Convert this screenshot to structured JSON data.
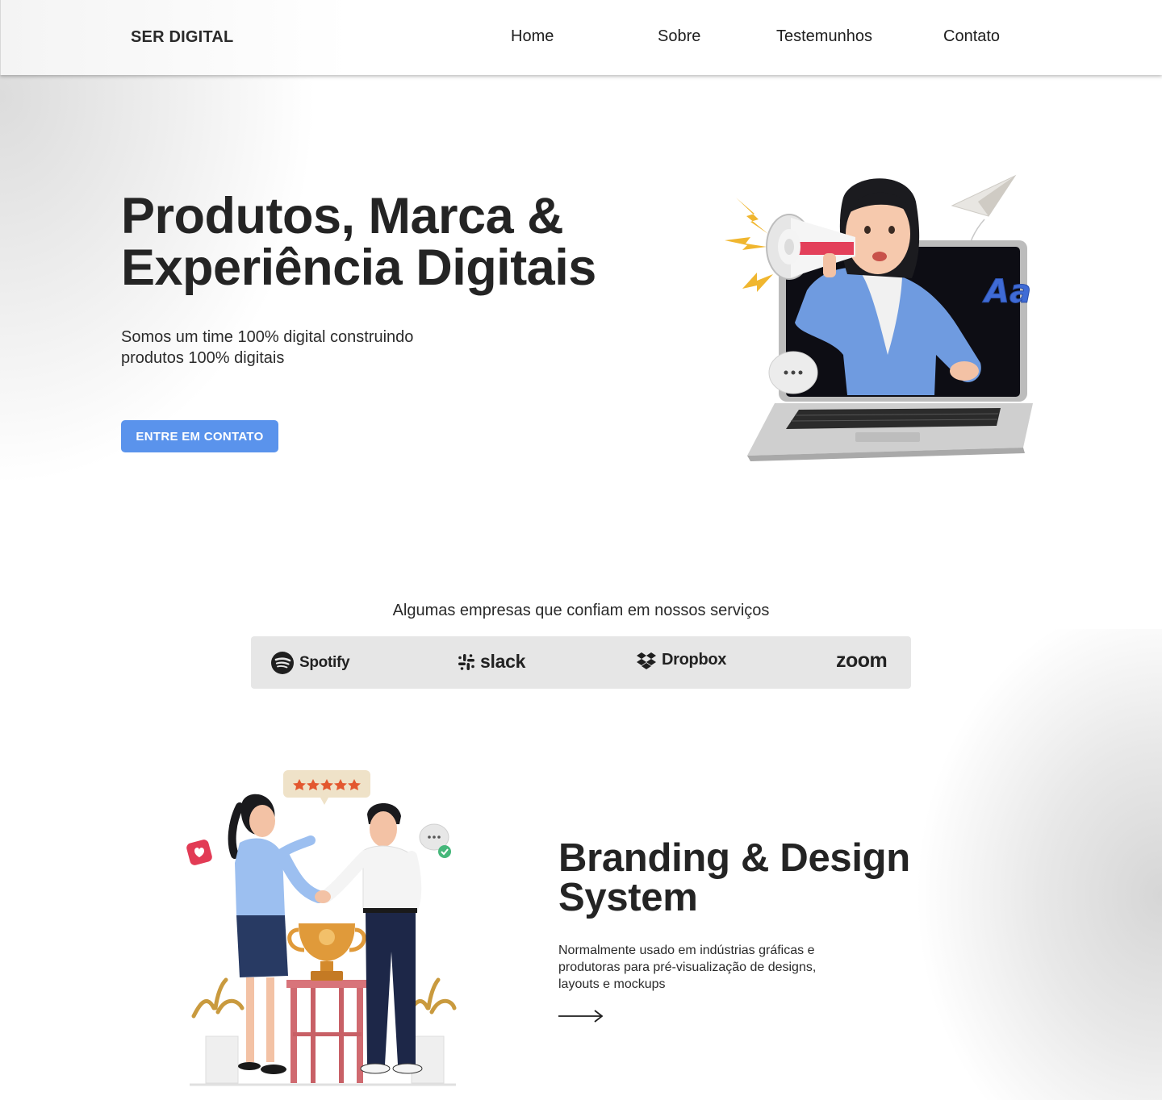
{
  "header": {
    "logo": "SER DIGITAL",
    "nav": [
      {
        "label": "Home"
      },
      {
        "label": "Sobre"
      },
      {
        "label": "Testemunhos"
      },
      {
        "label": "Contato"
      }
    ]
  },
  "hero": {
    "title_line1": "Produtos, Marca &",
    "title_line2": "Experiência Digitais",
    "subtitle_line1": "Somos um time 100% digital construindo",
    "subtitle_line2": "produtos 100% digitais",
    "cta_label": "ENTRE EM CONTATO",
    "illustration_badge": "Aa"
  },
  "partners": {
    "title": "Algumas empresas que confiam em nossos serviços",
    "brands": [
      {
        "name": "Spotify",
        "icon": "spotify-icon"
      },
      {
        "name": "slack",
        "icon": "slack-icon"
      },
      {
        "name": "Dropbox",
        "icon": "dropbox-icon"
      },
      {
        "name": "zoom",
        "icon": ""
      }
    ]
  },
  "branding": {
    "title_line1": "Branding & Design",
    "title_line2": "System",
    "desc_line1": "Normalmente usado em indústrias gráficas e",
    "desc_line2": "produtoras para pré-visualização de designs,",
    "desc_line3": "layouts e mockups",
    "arrow_icon": "arrow-right-icon"
  },
  "colors": {
    "cta": "#5a93ec",
    "partners_bar": "#e6e6e6",
    "text_dark": "#242424"
  }
}
